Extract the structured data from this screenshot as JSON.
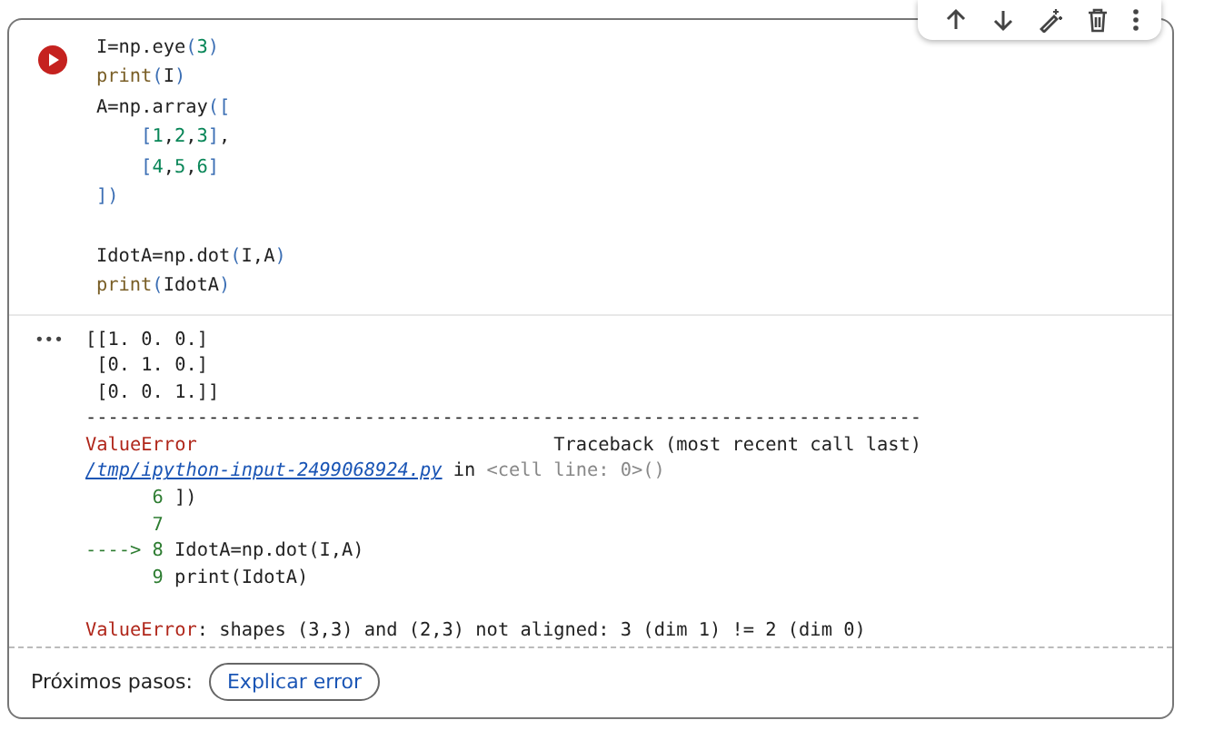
{
  "toolbar": {
    "buttons": [
      {
        "kind": "up"
      },
      {
        "kind": "down"
      },
      {
        "kind": "magic"
      },
      {
        "kind": "delete"
      },
      {
        "kind": "more"
      }
    ]
  },
  "cell": {
    "code_lines": [
      {
        "text": "I=np.eye(3)"
      },
      {
        "text": "print(I)"
      },
      {
        "text": "A=np.array(["
      },
      {
        "text": "    [1,2,3],"
      },
      {
        "text": "    [4,5,6]"
      },
      {
        "text": "])"
      },
      {
        "text": "IdotA=np.dot(I,A)",
        "blank_before": true
      },
      {
        "text": "print(IdotA)"
      }
    ],
    "output_marker": "•••",
    "output_lines": [
      {
        "kind": "text",
        "text": "[[1. 0. 0.]"
      },
      {
        "kind": "text",
        "text": " [0. 1. 0.]"
      },
      {
        "kind": "text",
        "text": " [0. 0. 1.]]"
      },
      {
        "kind": "text",
        "text": "---------------------------------------------------------------------------"
      },
      {
        "kind": "error",
        "name": "ValueError",
        "text": "                                Traceback (most recent call last)"
      },
      {
        "kind": "link",
        "link": "/tmp/ipython-input-2499068924.py",
        "text": "in",
        "ref": "<cell line: 0>()"
      },
      {
        "kind": "source",
        "prefix": "      6",
        "text": "])"
      },
      {
        "kind": "source",
        "prefix": "      7"
      },
      {
        "kind": "source",
        "prefix": "----> 8",
        "text": "IdotA=np.dot(I,A)"
      },
      {
        "kind": "source",
        "prefix": "      9",
        "text": "print(IdotA)"
      },
      {
        "kind": "error",
        "name": "ValueError",
        "text": ": shapes (3,3) and (2,3) not aligned: 3 (dim 1) != 2 (dim 0)",
        "blank_before": true
      }
    ]
  },
  "footer": {
    "label": "Próximos pasos:",
    "button": "Explicar error"
  }
}
